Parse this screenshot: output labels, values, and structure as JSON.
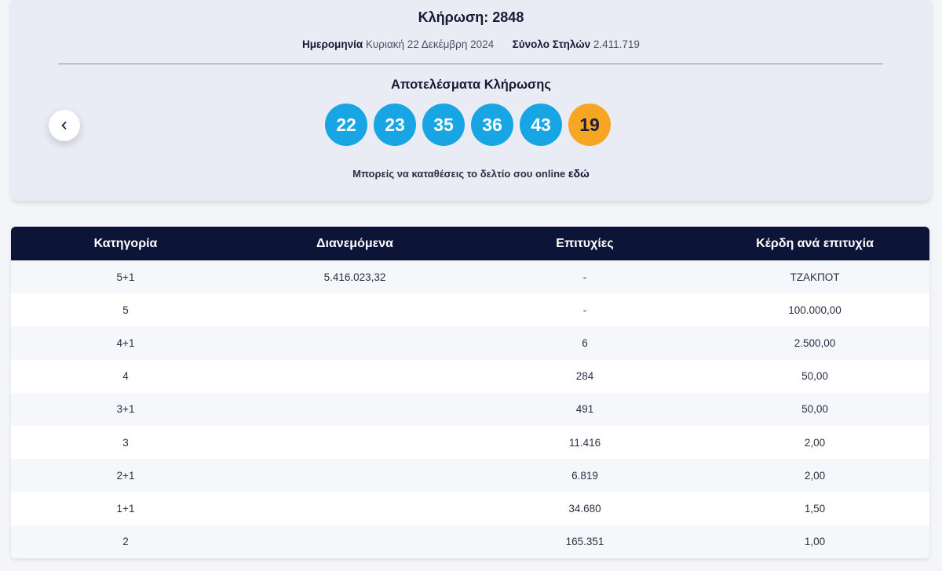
{
  "draw": {
    "title": "Κλήρωση: 2848",
    "date_label": "Ημερομηνία",
    "date_value": "Κυριακή 22 Δεκέμβρη 2024",
    "columns_label": "Σύνολο Στηλών",
    "columns_value": "2.411.719",
    "results_label": "Αποτελέσματα Κλήρωσης",
    "numbers": [
      "22",
      "23",
      "35",
      "36",
      "43"
    ],
    "joker": "19",
    "online_text": "Μπορείς να καταθέσεις το δελτίο σου online",
    "online_link": "εδώ"
  },
  "colors": {
    "header_bg": "#0c1538",
    "ball_main": "#17a6e3",
    "ball_joker": "#f6a623",
    "card_bg": "#e9ecf5"
  },
  "icons": {
    "prev": "chevron-left-icon"
  },
  "table": {
    "headers": [
      "Κατηγορία",
      "Διανεμόμενα",
      "Επιτυχίες",
      "Κέρδη ανά επιτυχία"
    ],
    "rows": [
      [
        "5+1",
        "5.416.023,32",
        "-",
        "ΤΖΑΚΠΟΤ"
      ],
      [
        "5",
        "",
        "-",
        "100.000,00"
      ],
      [
        "4+1",
        "",
        "6",
        "2.500,00"
      ],
      [
        "4",
        "",
        "284",
        "50,00"
      ],
      [
        "3+1",
        "",
        "491",
        "50,00"
      ],
      [
        "3",
        "",
        "11.416",
        "2,00"
      ],
      [
        "2+1",
        "",
        "6.819",
        "2,00"
      ],
      [
        "1+1",
        "",
        "34.680",
        "1,50"
      ],
      [
        "2",
        "",
        "165.351",
        "1,00"
      ]
    ]
  }
}
